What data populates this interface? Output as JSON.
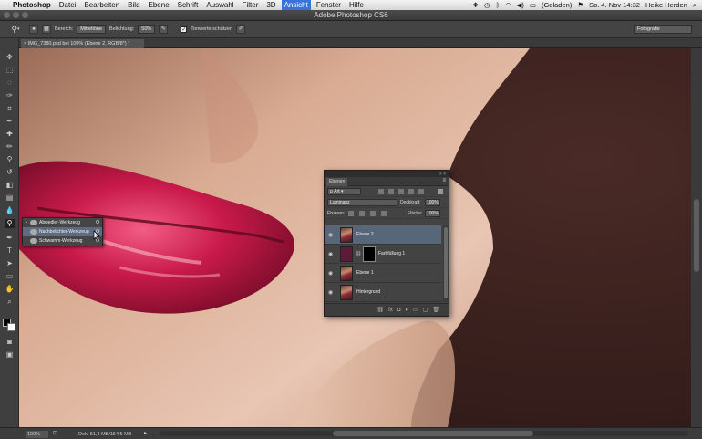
{
  "menubar": {
    "app": "Photoshop",
    "items": [
      "Datei",
      "Bearbeiten",
      "Bild",
      "Ebene",
      "Schrift",
      "Auswahl",
      "Filter",
      "3D",
      "Ansicht",
      "Fenster",
      "Hilfe"
    ],
    "battery": "(Geladen)",
    "datetime": "So. 4. Nov  14:32",
    "user": "Heike Herden"
  },
  "window": {
    "title": "Adobe Photoshop CS6"
  },
  "options": {
    "range_label": "Bereich:",
    "range_value": "Mitteltöne",
    "exposure_label": "Belichtung:",
    "exposure_value": "50%",
    "protect_label": "Tonwerte schützen",
    "workspace": "Fotografie"
  },
  "document_tab": "IMG_7380.psd bei 100% (Ebene 2, RGB/8*) *",
  "tool_flyout": {
    "items": [
      {
        "label": "Abwedler-Werkzeug",
        "shortcut": "O"
      },
      {
        "label": "Nachbelichter-Werkzeug",
        "shortcut": "O"
      },
      {
        "label": "Schwamm-Werkzeug",
        "shortcut": "O"
      }
    ]
  },
  "layers_panel": {
    "tab": "Ebenen",
    "filter_kind": "Art",
    "blend_mode": "Luminanz",
    "opacity_label": "Deckkraft:",
    "opacity_value": "100%",
    "lock_label": "Fixieren:",
    "fill_label": "Fläche:",
    "fill_value": "100%",
    "layers": [
      {
        "name": "Ebene 2"
      },
      {
        "name": "Farbfüllung 1"
      },
      {
        "name": "Ebene 1"
      },
      {
        "name": "Hintergrund"
      }
    ]
  },
  "status": {
    "zoom": "100%",
    "doc_info": "Dok: 51,3 MB/154,5 MB"
  }
}
